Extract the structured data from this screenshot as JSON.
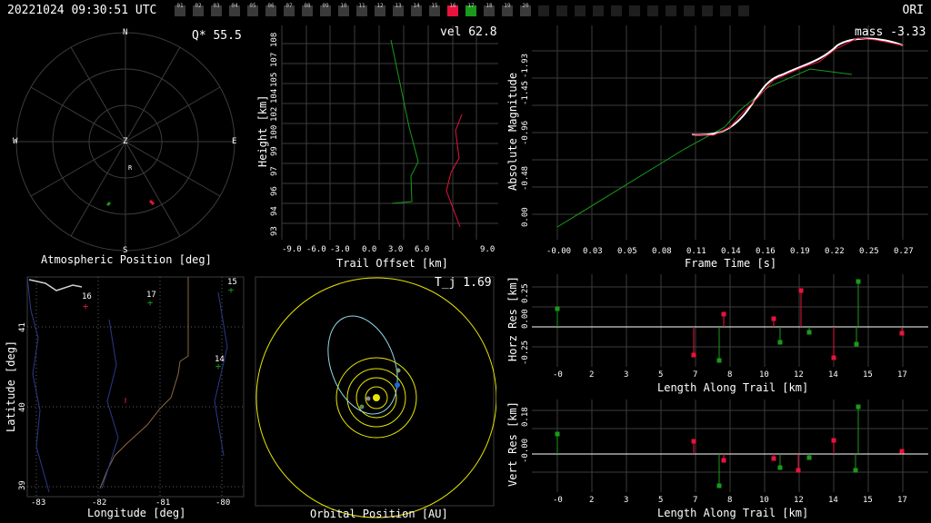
{
  "header": {
    "timestamp": "20221024 09:30:51 UTC",
    "station": "ORI",
    "cameras": [
      "01",
      "02",
      "03",
      "04",
      "05",
      "06",
      "07",
      "08",
      "09",
      "10",
      "11",
      "12",
      "13",
      "14",
      "15",
      "16",
      "17",
      "18",
      "19",
      "20"
    ],
    "active_red": "16",
    "active_green": "17"
  },
  "atmos": {
    "badge": "Q* 55.5",
    "label": "Atmospheric Position [deg]",
    "compass": {
      "n": "N",
      "s": "S",
      "e": "E",
      "w": "W",
      "z": "Z",
      "r": "R"
    }
  },
  "trail": {
    "badge": "vel 62.8",
    "xlabel": "Trail Offset [km]",
    "ylabel": "Height [km]",
    "xticks": [
      "-9.0",
      "-6.0",
      "-3.0",
      "0.0",
      "3.0",
      "6.0",
      "9.0"
    ],
    "yticks": [
      "93",
      "94",
      "96",
      "97",
      "99",
      "100",
      "102",
      "104",
      "105",
      "107",
      "108"
    ]
  },
  "mag": {
    "badge": "mass -3.33",
    "xlabel": "Frame Time [s]",
    "ylabel": "Absolute Magnitude",
    "xticks": [
      "-0.00",
      "0.03",
      "0.05",
      "0.08",
      "0.11",
      "0.14",
      "0.16",
      "0.19",
      "0.22",
      "0.25",
      "0.27"
    ],
    "yticks": [
      "0.00",
      "-0.48",
      "-0.96",
      "-1.45",
      "-1.93"
    ]
  },
  "map": {
    "xlabel": "Longitude [deg]",
    "ylabel": "Latitude [deg]",
    "xticks": [
      "-83",
      "-82",
      "-81",
      "-80"
    ],
    "yticks": [
      "39",
      "40",
      "41"
    ],
    "cam_labels": [
      "16",
      "17",
      "15",
      "14"
    ]
  },
  "orbit": {
    "badge": "T_j 1.69",
    "label": "Orbital Position [AU]"
  },
  "horz": {
    "xlabel": "Length Along Trail [km]",
    "ylabel": "Horz Res [km]",
    "xticks": [
      "-0",
      "2",
      "3",
      "5",
      "7",
      "8",
      "10",
      "12",
      "14",
      "15",
      "17"
    ],
    "yticks": [
      "0.25",
      "0.00",
      "-0.25"
    ]
  },
  "vert": {
    "xlabel": "Length Along Trail [km]",
    "ylabel": "Vert Res [km]",
    "xticks": [
      "-0",
      "2",
      "3",
      "5",
      "7",
      "8",
      "10",
      "12",
      "14",
      "15",
      "17"
    ],
    "yticks": [
      "0.18",
      "-0.00"
    ]
  },
  "colors": {
    "red": "#e8133c",
    "green": "#1a9a1a",
    "grid": "#3c3c3c",
    "yellow": "#e8e600",
    "cyan": "#8fd6e8"
  }
}
